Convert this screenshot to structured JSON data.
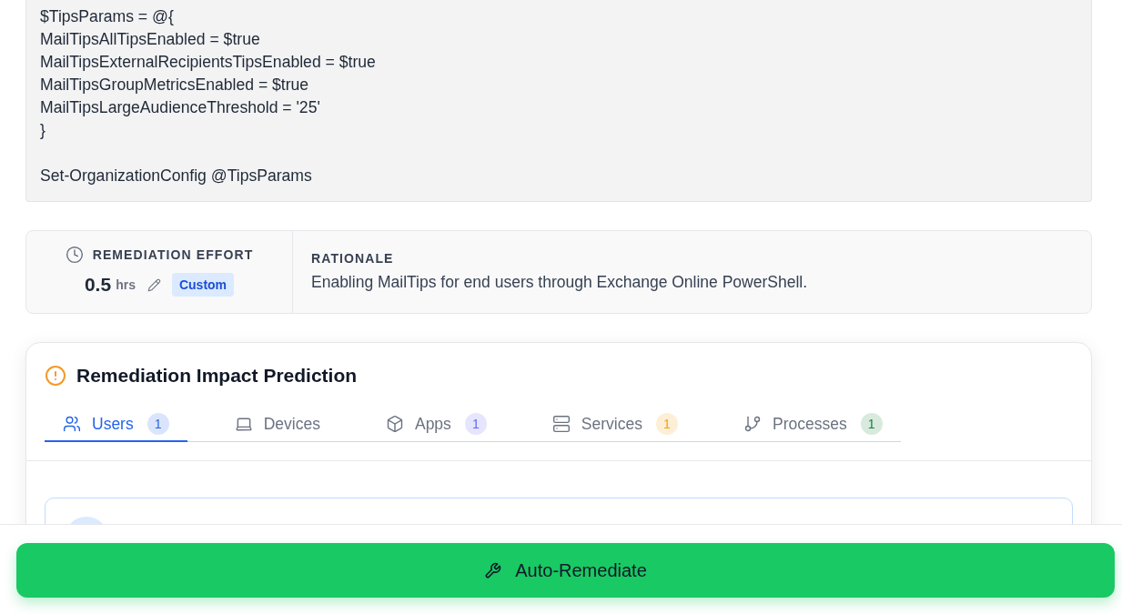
{
  "code_block": {
    "groups": [
      [
        "$TipsParams = @{",
        "MailTipsAllTipsEnabled = $true",
        "MailTipsExternalRecipientsTipsEnabled = $true",
        "MailTipsGroupMetricsEnabled = $true",
        "MailTipsLargeAudienceThreshold = '25'",
        "}"
      ],
      [
        "Set-OrganizationConfig @TipsParams"
      ]
    ]
  },
  "effort": {
    "label": "REMEDIATION EFFORT",
    "value": "0.5",
    "unit": "hrs",
    "badge": "Custom"
  },
  "rationale": {
    "label": "RATIONALE",
    "text": "Enabling MailTips for end users through Exchange Online PowerShell."
  },
  "impact": {
    "title": "Remediation Impact Prediction",
    "tabs": [
      {
        "label": "Users",
        "count": "1",
        "color": "#2563eb",
        "selected": true
      },
      {
        "label": "Devices",
        "selected": false
      },
      {
        "label": "Apps",
        "count": "1",
        "color": "#6366f1",
        "selected": false
      },
      {
        "label": "Services",
        "count": "1",
        "color": "#f59e0b",
        "selected": false
      },
      {
        "label": "Processes",
        "count": "1",
        "color": "#15803d",
        "selected": false
      }
    ]
  },
  "footer": {
    "button": "Auto-Remediate"
  }
}
